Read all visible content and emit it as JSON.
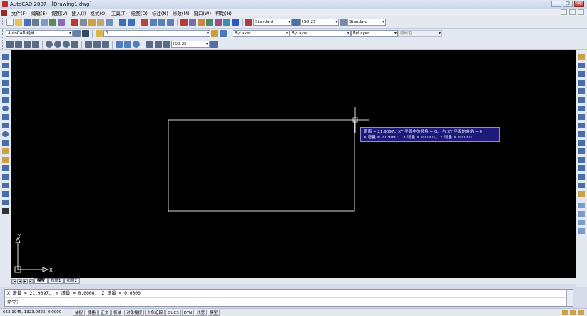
{
  "window": {
    "title": "AutoCAD 2007 - [Drawing1.dwg]",
    "minimize_glyph": "–",
    "maximize_glyph": "❐",
    "close_glyph": "✕"
  },
  "menu": {
    "items": [
      "文件(F)",
      "编辑(E)",
      "视图(V)",
      "插入(I)",
      "格式(O)",
      "工具(T)",
      "绘图(D)",
      "标注(N)",
      "修改(M)",
      "窗口(W)",
      "帮助(H)"
    ]
  },
  "toolbar": {
    "text_style": "Standard",
    "dim_style": "ISO-25",
    "table_style": "Standard",
    "workspace": "AutoCAD 经典",
    "layer": "0",
    "color": "ByLayer",
    "linetype": "ByLayer",
    "lineweight": "ByLayer",
    "plot_style": "随颜色",
    "dim_style_2": "ISO-25"
  },
  "canvas": {
    "tooltip_line1": "距离 = 21.9097，XY 平面中的倾角 = 0，    与 XY 平面的夹角 = 0",
    "tooltip_line2": "X 增量 = 21.9097，   Y 增量 = 0.0000，    Z 增量 = 0.0000",
    "ucs_x": "X",
    "ucs_y": "Y"
  },
  "tabs": {
    "items": [
      "模型",
      "布局1",
      "布局2"
    ],
    "active": 0
  },
  "command": {
    "history": "X 增量 = 21.9097，   Y 增量 = 0.0000，    Z 增量 = 0.0000",
    "prompt": "命令："
  },
  "status": {
    "coords": "-663.1945, 1323.0823, 0.0000",
    "buttons": [
      "捕捉",
      "栅格",
      "正交",
      "极轴",
      "对象捕捉",
      "对象追踪",
      "DUCS",
      "DYN",
      "线宽",
      "模型"
    ]
  },
  "colors": {
    "canvas": "#000000",
    "tooltip_bg": "#1f1a7a",
    "chrome": "#e4e8f1",
    "accent": "#2a56c6"
  }
}
